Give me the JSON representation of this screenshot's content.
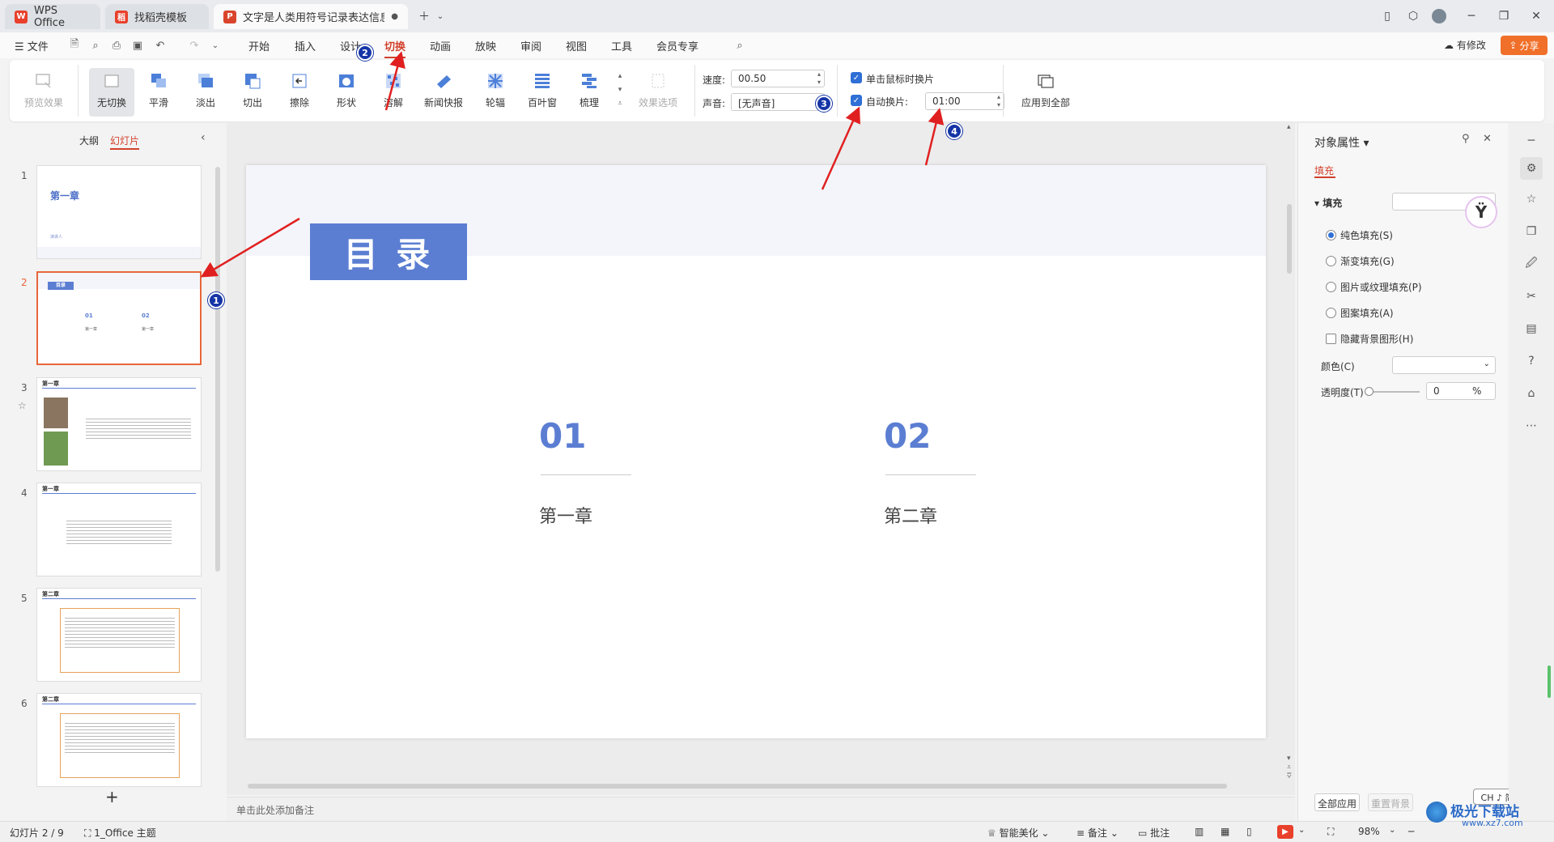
{
  "tabs": [
    {
      "label": "WPS Office"
    },
    {
      "label": "找稻壳模板"
    },
    {
      "label": "文字是人类用符号记录表达信息以"
    }
  ],
  "menu": {
    "file": "文件",
    "items": [
      "开始",
      "插入",
      "设计",
      "切换",
      "动画",
      "放映",
      "审阅",
      "视图",
      "工具",
      "会员专享"
    ],
    "active": "切换",
    "modify": "有修改",
    "share": "分享"
  },
  "ribbon": {
    "preview": "预览效果",
    "transitions": [
      "无切换",
      "平滑",
      "淡出",
      "切出",
      "擦除",
      "形状",
      "溶解",
      "新闻快报",
      "轮辐",
      "百叶窗",
      "梳理"
    ],
    "effect_options": "效果选项",
    "speed_label": "速度:",
    "speed_value": "00.50",
    "sound_label": "声音:",
    "sound_value": "[无声音]",
    "on_click_label": "单击鼠标时换片",
    "auto_label": "自动换片:",
    "auto_value": "01:00",
    "apply_all": "应用到全部"
  },
  "left_pane": {
    "tab_outline": "大纲",
    "tab_slides": "幻灯片",
    "slide_numbers": [
      "1",
      "2",
      "3",
      "4",
      "5",
      "6"
    ],
    "thumbs": {
      "s1_title": "第一章",
      "s1_sub": "演讲人",
      "s2_title": "目录",
      "s2_n1": "01",
      "s2_n2": "02",
      "s2_c1": "第一章",
      "s2_c2": "第一章",
      "s3_title": "第一章",
      "s4_title": "第一章",
      "s5_title": "第二章",
      "s6_title": "第二章"
    },
    "add_icon": "+"
  },
  "slide": {
    "title": "目 录",
    "item1_num": "01",
    "item1_label": "第一章",
    "item2_num": "02",
    "item2_label": "第二章"
  },
  "notes_placeholder": "单击此处添加备注",
  "right_pane": {
    "title": "对象属性",
    "tab": "填充",
    "section": "填充",
    "options": [
      "纯色填充(S)",
      "渐变填充(G)",
      "图片或纹理填充(P)",
      "图案填充(A)"
    ],
    "hide_bg": "隐藏背景图形(H)",
    "color_label": "颜色(C)",
    "transparency_label": "透明度(T)",
    "transparency_value": "0",
    "transparency_unit": "%",
    "apply_all": "全部应用",
    "reset_bg": "重置背景",
    "ime": "CH ♪ 简"
  },
  "status": {
    "slide_info": "幻灯片 2 / 9",
    "theme": "1_Office 主题",
    "beautify": "智能美化",
    "notes": "备注",
    "comments": "批注",
    "zoom": "98%"
  },
  "watermark": {
    "line1": "极光下载站",
    "line2": "www.xz7.com"
  },
  "annotations": [
    "1",
    "2",
    "3",
    "4"
  ],
  "colors": {
    "accent": "#d2412c",
    "slide_blue": "#5b7ed2",
    "badge": "#1535a6",
    "arrow": "#e02020"
  }
}
